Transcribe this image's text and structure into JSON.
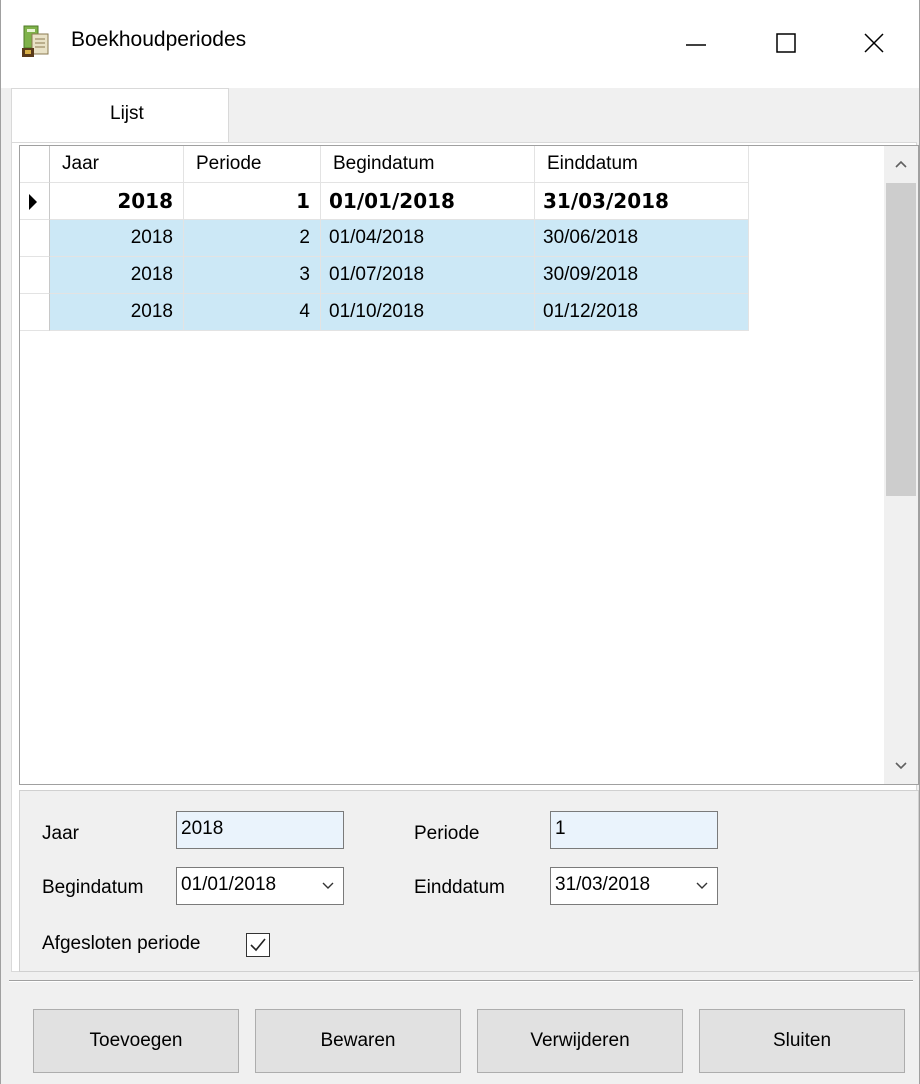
{
  "window": {
    "title": "Boekhoudperiodes",
    "icon": "ledger-app-icon",
    "controls": [
      "minimize-icon",
      "maximize-icon",
      "close-icon"
    ]
  },
  "tabs": [
    {
      "label": "Lijst",
      "selected": true
    }
  ],
  "grid": {
    "columns": [
      "Jaar",
      "Periode",
      "Begindatum",
      "Einddatum"
    ],
    "rows": [
      {
        "jaar": "2018",
        "periode": "1",
        "begindatum": "01/01/2018",
        "einddatum": "31/03/2018",
        "current": true
      },
      {
        "jaar": "2018",
        "periode": "2",
        "begindatum": "01/04/2018",
        "einddatum": "30/06/2018",
        "current": false
      },
      {
        "jaar": "2018",
        "periode": "3",
        "begindatum": "01/07/2018",
        "einddatum": "30/09/2018",
        "current": false
      },
      {
        "jaar": "2018",
        "periode": "4",
        "begindatum": "01/10/2018",
        "einddatum": "01/12/2018",
        "current": false
      }
    ],
    "selection_color": "#cce8f6"
  },
  "form": {
    "jaar_label": "Jaar",
    "jaar_value": "2018",
    "periode_label": "Periode",
    "periode_value": "1",
    "begindatum_label": "Begindatum",
    "begindatum_value": "01/01/2018",
    "einddatum_label": "Einddatum",
    "einddatum_value": "31/03/2018",
    "afgesloten_label": "Afgesloten periode",
    "afgesloten_checked": true
  },
  "buttons": {
    "add": "Toevoegen",
    "save": "Bewaren",
    "delete": "Verwijderen",
    "close": "Sluiten"
  }
}
